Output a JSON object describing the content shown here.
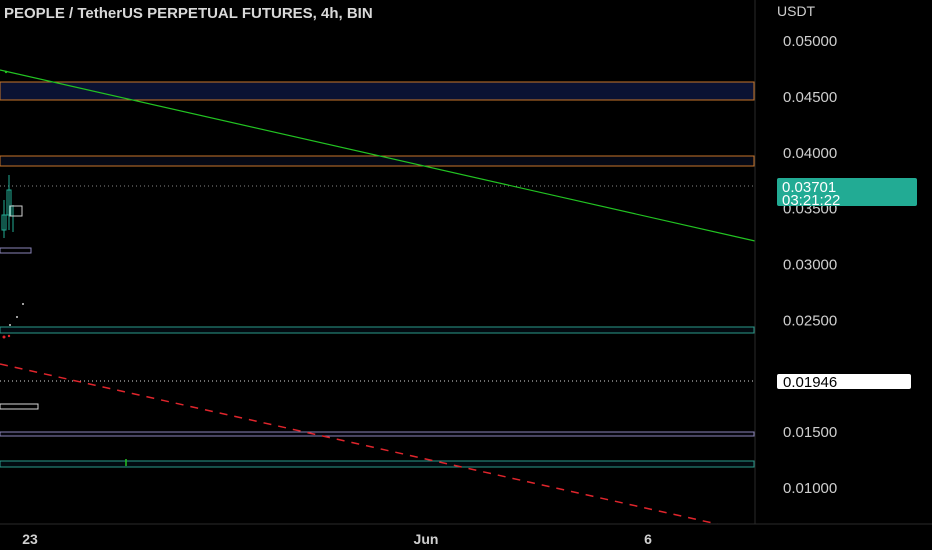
{
  "colors": {
    "background": "#000000",
    "last_price_badge": "#22ab94",
    "marker_badge": "#ffffff",
    "trend_green": "#22c322",
    "trend_red": "#e0252c",
    "zone_orange": "#c8752a",
    "zone_teal": "#2a9a8a",
    "zone_purple": "#8a84b8",
    "zone_fill": "#0b1233"
  },
  "header": {
    "title": "PEOPLE / TetherUS PERPETUAL FUTURES, 4h, BIN"
  },
  "price_axis": {
    "unit": "USDT",
    "last_price": "0.03701",
    "countdown": "03:21:22",
    "marker_price": "0.01946"
  },
  "chart_data": {
    "type": "line",
    "title": "PEOPLE / TetherUS PERPETUAL FUTURES, 4h, BIN",
    "ylabel": "USDT",
    "y_ticks": [
      "0.05000",
      "0.04500",
      "0.04000",
      "0.03500",
      "0.03000",
      "0.02500",
      "0.01500",
      "0.01000"
    ],
    "ylim": [
      0.0066,
      0.0555
    ],
    "x_ticks": [
      "23",
      "Jun",
      "6"
    ],
    "last_price": 0.03701,
    "marker_price": 0.01946,
    "horizontal_zones": [
      {
        "name": "resistance-zone-upper",
        "low": 0.0448,
        "high": 0.0463,
        "color": "orange"
      },
      {
        "name": "resistance-zone-lower",
        "low": 0.0387,
        "high": 0.0396,
        "color": "orange"
      },
      {
        "name": "support-zone-upper",
        "low": 0.0237,
        "high": 0.0243,
        "color": "teal"
      },
      {
        "name": "support-zone-middle",
        "low": 0.0149,
        "high": 0.0152,
        "color": "purple"
      },
      {
        "name": "support-zone-lower",
        "low": 0.0119,
        "high": 0.0124,
        "color": "teal"
      }
    ],
    "series": [
      {
        "type": "trendline",
        "style": "solid",
        "color": "green",
        "points": [
          [
            0,
            0.0472
          ],
          [
            755,
            0.0321
          ]
        ]
      },
      {
        "type": "trendline",
        "style": "dashed",
        "color": "red",
        "points": [
          [
            0,
            0.0214
          ],
          [
            735,
            0.0074
          ]
        ]
      }
    ],
    "grid": false
  }
}
